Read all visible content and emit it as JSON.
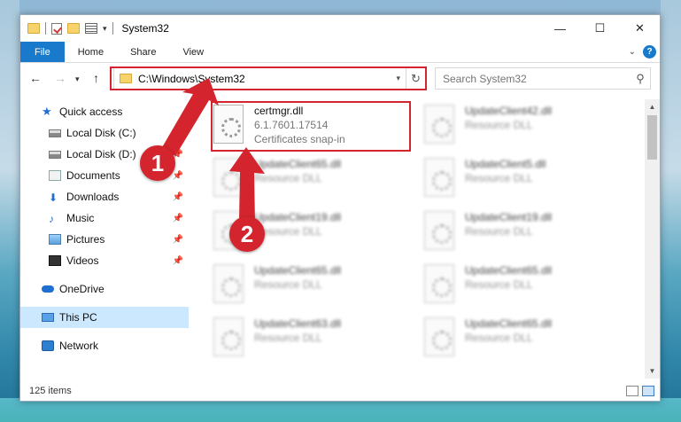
{
  "window": {
    "title": "System32",
    "controls": {
      "minimize": "—",
      "maximize": "☐",
      "close": "✕"
    }
  },
  "ribbon": {
    "tabs": [
      "File",
      "Home",
      "Share",
      "View"
    ],
    "help": "?"
  },
  "nav": {
    "address": "C:\\Windows\\System32",
    "search_placeholder": "Search System32"
  },
  "sidebar": {
    "items": [
      {
        "label": "Quick access",
        "icon": "star-icon"
      },
      {
        "label": "Local Disk (C:)",
        "icon": "disk-icon",
        "pinned": true
      },
      {
        "label": "Local Disk (D:)",
        "icon": "disk-icon",
        "pinned": true
      },
      {
        "label": "Documents",
        "icon": "documents-icon",
        "pinned": true
      },
      {
        "label": "Downloads",
        "icon": "download-icon",
        "pinned": true
      },
      {
        "label": "Music",
        "icon": "music-icon",
        "pinned": true
      },
      {
        "label": "Pictures",
        "icon": "pictures-icon",
        "pinned": true
      },
      {
        "label": "Videos",
        "icon": "videos-icon",
        "pinned": true
      },
      {
        "label": "OneDrive",
        "icon": "cloud-icon"
      },
      {
        "label": "This PC",
        "icon": "computer-icon",
        "selected": true
      },
      {
        "label": "Network",
        "icon": "network-icon"
      }
    ]
  },
  "files": {
    "highlighted": {
      "name": "certmgr.dll",
      "version": "6.1.7601.17514",
      "description": "Certificates snap-in"
    },
    "left_column": [
      {
        "name": "UpdateClient65.dll",
        "description": "Resource DLL"
      },
      {
        "name": "UpdateClient19.dll",
        "description": "Resource DLL"
      },
      {
        "name": "UpdateClient65.dll",
        "description": "Resource DLL"
      },
      {
        "name": "UpdateClient63.dll",
        "description": "Resource DLL"
      }
    ],
    "right_column": [
      {
        "name": "UpdateClient42.dll",
        "description": "Resource DLL"
      },
      {
        "name": "UpdateClient5.dll",
        "description": "Resource DLL"
      },
      {
        "name": "UpdateClient19.dll",
        "description": "Resource DLL"
      },
      {
        "name": "UpdateClient65.dll",
        "description": "Resource DLL"
      },
      {
        "name": "UpdateClient65.dll",
        "description": "Resource DLL"
      }
    ]
  },
  "status": {
    "count": "125 items"
  },
  "annotations": {
    "step1": "1",
    "step2": "2",
    "color": "#d4242e"
  },
  "colors": {
    "accent": "#1979ca",
    "selection": "#cce8ff",
    "highlight_box": "#d4242e"
  }
}
